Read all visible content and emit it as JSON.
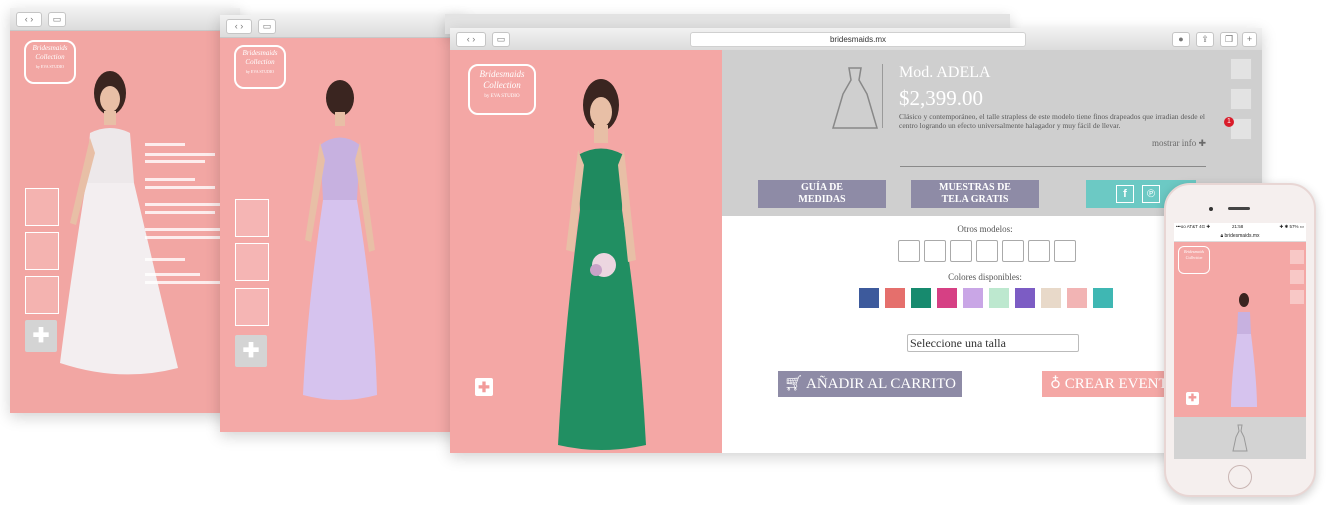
{
  "browser": {
    "url": "bridesmaids.mx",
    "url_alt": "bridesmaids.mx"
  },
  "logo": {
    "line1": "Bridesmaids",
    "line2": "Collection",
    "line3": "by EVA STUDIO"
  },
  "product": {
    "title": "Mod. ADELA",
    "price": "$2,399.00",
    "description": "Clásico y contemporáneo, el talle strapless de este modelo tiene finos drapeados que irradian desde el centro logrando un efecto universalmente halagador y muy fácil de llevar.",
    "more_info": "mostrar info ✚",
    "cart_badge": "1"
  },
  "buttons": {
    "size_guide_l1": "GUÍA DE",
    "size_guide_l2": "MEDIDAS",
    "samples_l1": "MUESTRAS DE",
    "samples_l2": "TELA GRATIS",
    "add_to_cart": "AÑADIR AL CARRITO",
    "create_event": "CREAR EVENT"
  },
  "section_labels": {
    "other_models": "Otros modelos:",
    "colors": "Colores disponibles:"
  },
  "size_select": {
    "value": "Seleccione una talla"
  },
  "colors": [
    "#3d5a9c",
    "#e56f6c",
    "#178a6e",
    "#d64084",
    "#c9a6e6",
    "#bde8cf",
    "#7c5cc4",
    "#e8d9c9",
    "#f2b4b4",
    "#3fb7b3"
  ],
  "phone": {
    "carrier": "•••oo AT&T 4G ✚",
    "time": "21:58",
    "battery": "✚ ✱ 57% ▭",
    "url": "bridesmaids.mx"
  },
  "icons": {
    "plus": "✚",
    "facebook": "f",
    "pinterest": "℗"
  }
}
